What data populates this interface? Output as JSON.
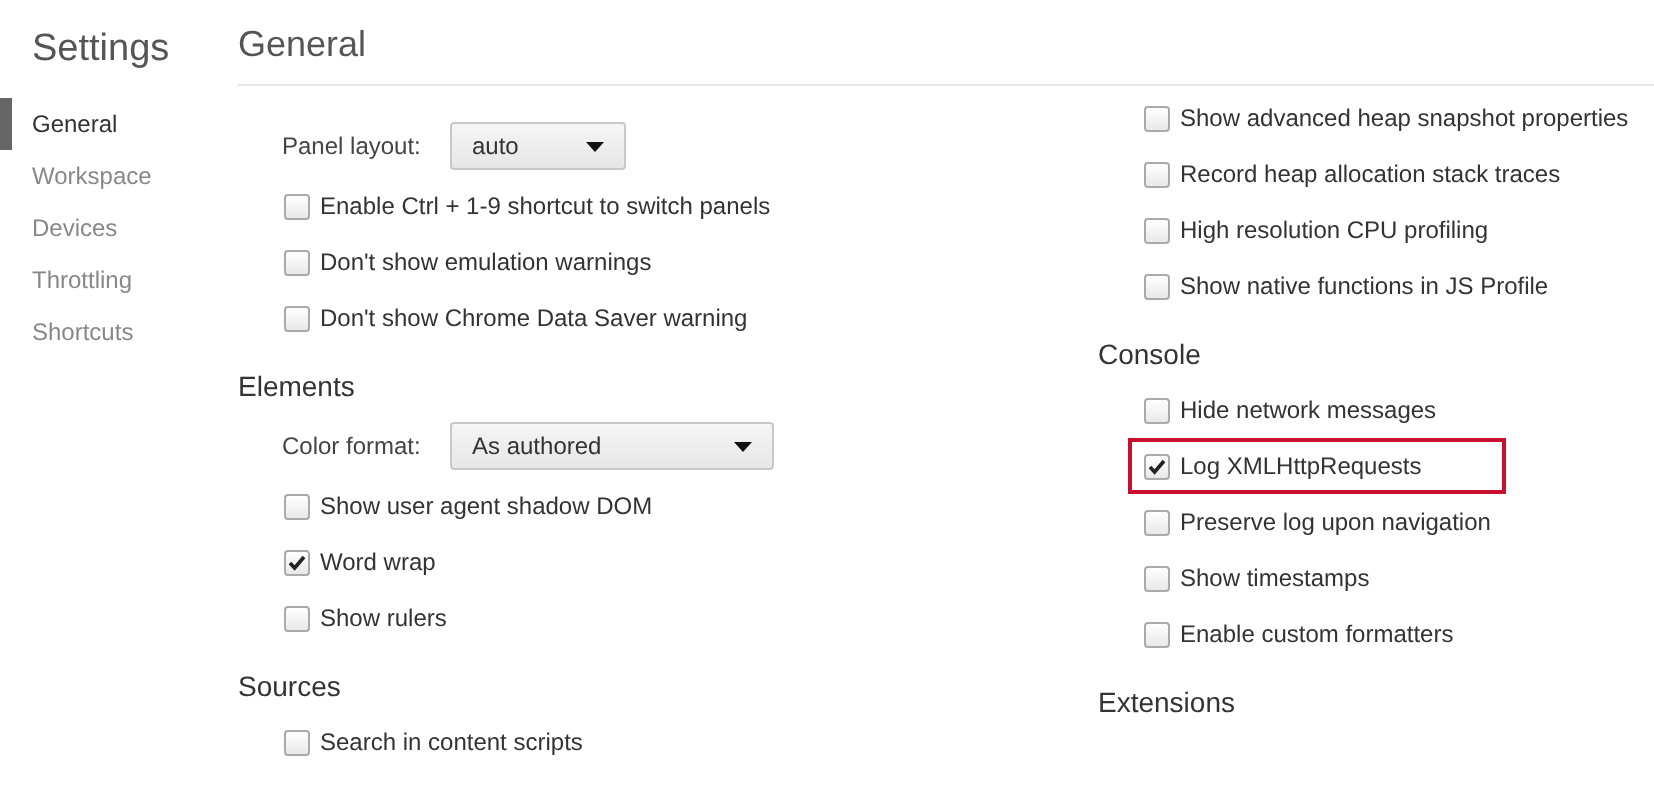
{
  "sidebar": {
    "title": "Settings",
    "items": [
      {
        "label": "General",
        "selected": true
      },
      {
        "label": "Workspace",
        "selected": false
      },
      {
        "label": "Devices",
        "selected": false
      },
      {
        "label": "Throttling",
        "selected": false
      },
      {
        "label": "Shortcuts",
        "selected": false
      }
    ]
  },
  "page": {
    "title": "General"
  },
  "columns": [
    [
      {
        "rows": [
          {
            "kind": "select",
            "label": "Panel layout:",
            "value": "auto"
          },
          {
            "kind": "checkbox",
            "label": "Enable Ctrl + 1-9 shortcut to switch panels",
            "checked": false,
            "highlighted": false
          },
          {
            "kind": "checkbox",
            "label": "Don't show emulation warnings",
            "checked": false,
            "highlighted": false
          },
          {
            "kind": "checkbox",
            "label": "Don't show Chrome Data Saver warning",
            "checked": false,
            "highlighted": false
          }
        ]
      },
      {
        "title": "Elements",
        "rows": [
          {
            "kind": "select",
            "label": "Color format:",
            "value": "As authored"
          },
          {
            "kind": "checkbox",
            "label": "Show user agent shadow DOM",
            "checked": false,
            "highlighted": false
          },
          {
            "kind": "checkbox",
            "label": "Word wrap",
            "checked": true,
            "highlighted": false
          },
          {
            "kind": "checkbox",
            "label": "Show rulers",
            "checked": false,
            "highlighted": false
          }
        ]
      },
      {
        "title": "Sources",
        "rows": [
          {
            "kind": "checkbox",
            "label": "Search in content scripts",
            "checked": false,
            "highlighted": false
          }
        ]
      }
    ],
    [
      {
        "rows": [
          {
            "kind": "checkbox",
            "label": "Show advanced heap snapshot properties",
            "checked": false,
            "highlighted": false
          },
          {
            "kind": "checkbox",
            "label": "Record heap allocation stack traces",
            "checked": false,
            "highlighted": false
          },
          {
            "kind": "checkbox",
            "label": "High resolution CPU profiling",
            "checked": false,
            "highlighted": false
          },
          {
            "kind": "checkbox",
            "label": "Show native functions in JS Profile",
            "checked": false,
            "highlighted": false
          }
        ]
      },
      {
        "title": "Console",
        "rows": [
          {
            "kind": "checkbox",
            "label": "Hide network messages",
            "checked": false,
            "highlighted": false
          },
          {
            "kind": "checkbox",
            "label": "Log XMLHttpRequests",
            "checked": true,
            "highlighted": true
          },
          {
            "kind": "checkbox",
            "label": "Preserve log upon navigation",
            "checked": false,
            "highlighted": false
          },
          {
            "kind": "checkbox",
            "label": "Show timestamps",
            "checked": false,
            "highlighted": false
          },
          {
            "kind": "checkbox",
            "label": "Enable custom formatters",
            "checked": false,
            "highlighted": false
          }
        ]
      },
      {
        "title": "Extensions"
      }
    ]
  ]
}
